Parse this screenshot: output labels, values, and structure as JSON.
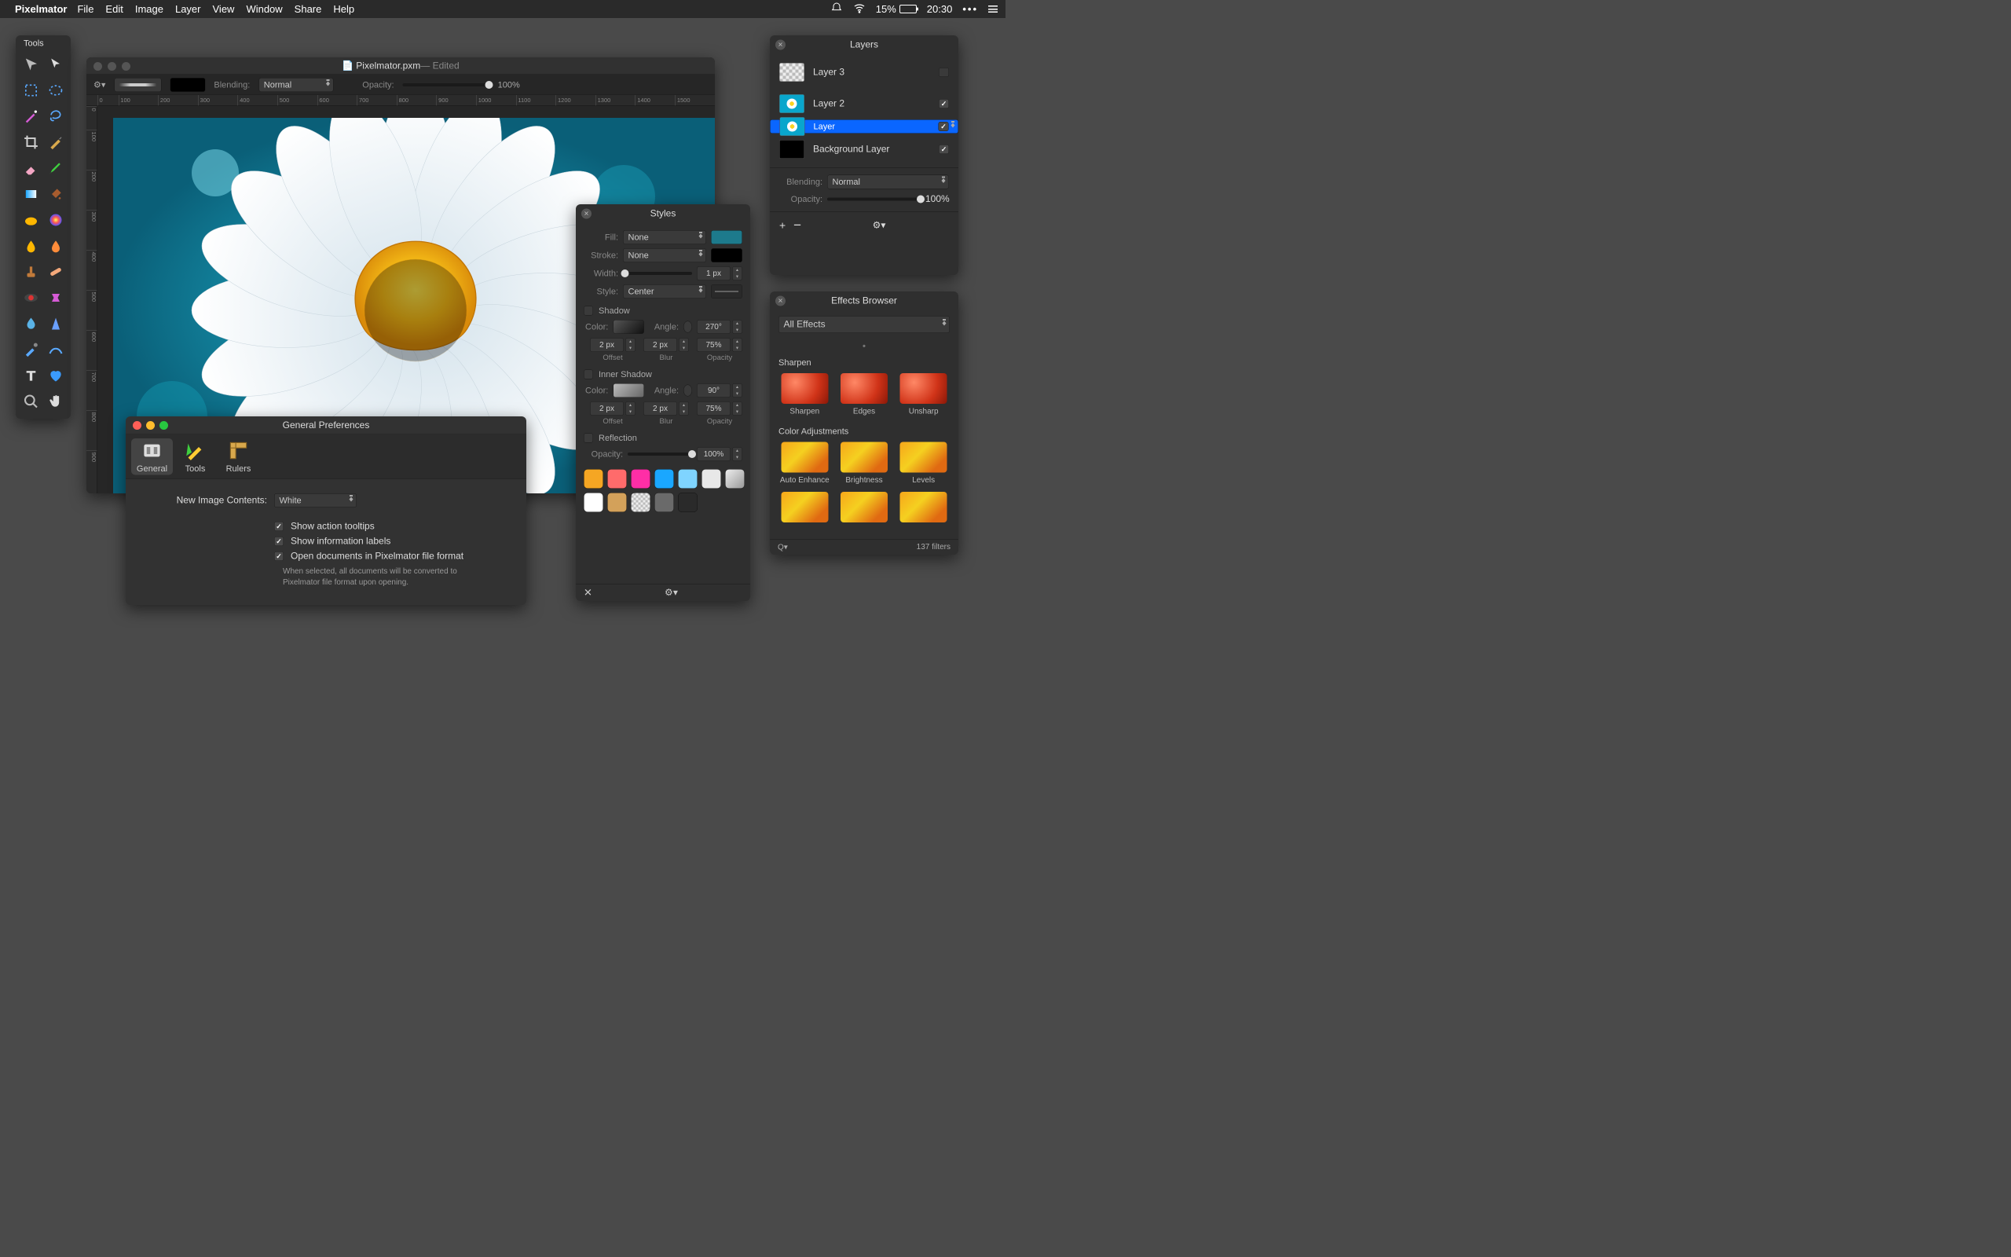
{
  "menubar": {
    "app": "Pixelmator",
    "items": [
      "File",
      "Edit",
      "Image",
      "Layer",
      "View",
      "Window",
      "Share",
      "Help"
    ],
    "battery_pct": "15%",
    "clock": "20:30"
  },
  "tools": {
    "title": "Tools"
  },
  "document": {
    "title": "Pixelmator.pxm",
    "status": " — Edited",
    "blending_label": "Blending:",
    "blending_value": "Normal",
    "opacity_label": "Opacity:",
    "opacity_value": "100%",
    "ruler_h": [
      "0",
      "100",
      "200",
      "300",
      "400",
      "500",
      "600",
      "700",
      "800",
      "900",
      "1000",
      "1100",
      "1200",
      "1300",
      "1400",
      "1500"
    ],
    "ruler_v": [
      "0",
      "100",
      "200",
      "300",
      "400",
      "500",
      "600",
      "700",
      "800",
      "900"
    ]
  },
  "styles": {
    "title": "Styles",
    "fill": "Fill:",
    "fill_val": "None",
    "fill_color": "#1d7a8c",
    "stroke": "Stroke:",
    "stroke_val": "None",
    "stroke_color": "#000000",
    "width": "Width:",
    "width_val": "1 px",
    "style": "Style:",
    "style_val": "Center",
    "shadow": "Shadow",
    "inner_shadow": "Inner Shadow",
    "reflection": "Reflection",
    "color": "Color:",
    "angle": "Angle:",
    "shadow_angle": "270°",
    "inner_angle": "90°",
    "offset": "Offset",
    "offset_v": "2 px",
    "blur": "Blur",
    "blur_v": "2 px",
    "opacity": "Opacity",
    "opacity_v": "75%",
    "refl_opacity": "Opacity:",
    "refl_val": "100%",
    "swatches": [
      "#f5a623",
      "#ff6b6b",
      "#ff2ea6",
      "#1aa7ff",
      "#7fd4ff",
      "#e8e8e8",
      "#9aa0a6",
      "#ffffff",
      "#d3a15a",
      "#b0b0b0",
      "#6a6a6a",
      "#2a2a2a"
    ]
  },
  "layers": {
    "title": "Layers",
    "items": [
      {
        "name": "Layer 3",
        "thumb": "tr",
        "visible": false
      },
      {
        "name": "Layer 2",
        "thumb": "img",
        "visible": true
      },
      {
        "name": "Layer",
        "thumb": "img",
        "visible": true,
        "selected": true
      },
      {
        "name": "Background Layer",
        "thumb": "bk",
        "visible": true
      }
    ],
    "blending_label": "Blending:",
    "blending_value": "Normal",
    "opacity_label": "Opacity:",
    "opacity_value": "100%"
  },
  "effects": {
    "title": "Effects Browser",
    "filter": "All Effects",
    "cat1": "Sharpen",
    "items1": [
      "Sharpen",
      "Edges",
      "Unsharp"
    ],
    "cat2": "Color Adjustments",
    "items2": [
      "Auto Enhance",
      "Brightness",
      "Levels"
    ],
    "count": "137 filters"
  },
  "prefs": {
    "title": "General Preferences",
    "tabs": [
      "General",
      "Tools",
      "Rulers"
    ],
    "new_image": "New Image Contents:",
    "new_image_val": "White",
    "ck1": "Show action tooltips",
    "ck2": "Show information labels",
    "ck3": "Open documents in Pixelmator file format",
    "note": "When selected, all documents will be converted to Pixelmator file format upon opening."
  }
}
